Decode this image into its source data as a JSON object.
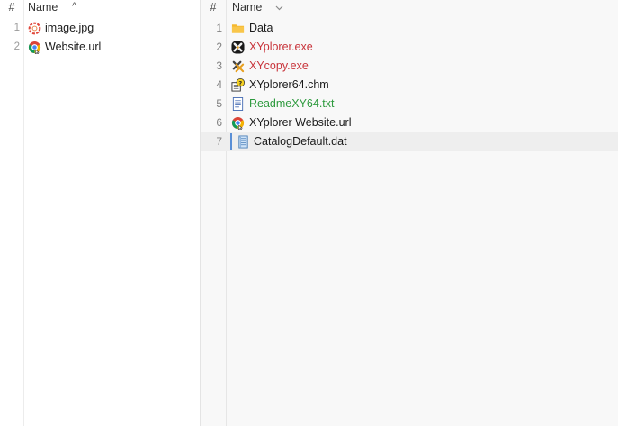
{
  "left_pane": {
    "header": {
      "num_label": "#",
      "name_label": "Name",
      "sort_arrow": "^"
    },
    "files": [
      {
        "num": "1",
        "name": "image.jpg",
        "icon": "image-file-icon",
        "color": "#1a1a1a"
      },
      {
        "num": "2",
        "name": "Website.url",
        "icon": "chrome-url-icon",
        "color": "#1a1a1a"
      }
    ]
  },
  "right_pane": {
    "header": {
      "num_label": "#",
      "name_label": "Name",
      "sort_arrow": "v"
    },
    "files": [
      {
        "num": "1",
        "name": "Data",
        "icon": "folder-icon",
        "color": "#1a1a1a"
      },
      {
        "num": "2",
        "name": "XYplorer.exe",
        "icon": "xyplorer-app-icon",
        "color": "#c8333a"
      },
      {
        "num": "3",
        "name": "XYcopy.exe",
        "icon": "xycopy-app-icon",
        "color": "#c8333a"
      },
      {
        "num": "4",
        "name": "XYplorer64.chm",
        "icon": "help-file-icon",
        "color": "#1a1a1a"
      },
      {
        "num": "5",
        "name": "ReadmeXY64.txt",
        "icon": "text-file-icon",
        "color": "#2e9a3e"
      },
      {
        "num": "6",
        "name": "XYplorer Website.url",
        "icon": "chrome-url-icon",
        "color": "#1a1a1a"
      },
      {
        "num": "7",
        "name": "CatalogDefault.dat",
        "icon": "data-file-icon",
        "color": "#1a1a1a",
        "selected": true
      }
    ]
  }
}
